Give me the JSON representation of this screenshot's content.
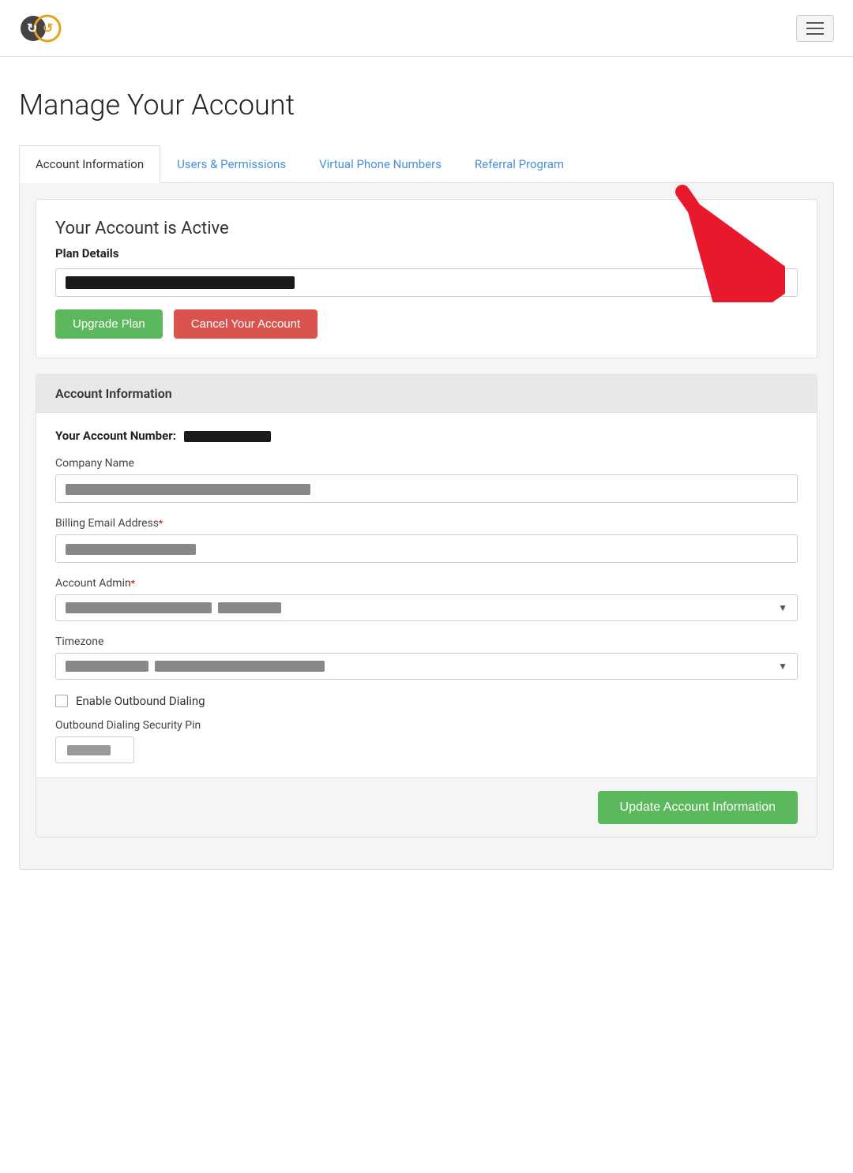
{
  "app": {
    "logo_alt": "CallFire Logo"
  },
  "navbar": {
    "hamburger_label": "Toggle navigation"
  },
  "page": {
    "title": "Manage Your Account"
  },
  "tabs": [
    {
      "id": "account-information",
      "label": "Account Information",
      "active": true
    },
    {
      "id": "users-permissions",
      "label": "Users & Permissions",
      "active": false
    },
    {
      "id": "virtual-phone-numbers",
      "label": "Virtual Phone Numbers",
      "active": false
    },
    {
      "id": "referral-program",
      "label": "Referral Program",
      "active": false
    }
  ],
  "plan_card": {
    "status_text": "Your Account is Active",
    "plan_details_label": "Plan Details",
    "upgrade_button": "Upgrade Plan",
    "cancel_button": "Cancel Your Account"
  },
  "account_info_card": {
    "section_title": "Account Information",
    "account_number_label": "Your Account Number:",
    "company_name_label": "Company Name",
    "billing_email_label": "Billing Email Address",
    "billing_email_required": true,
    "account_admin_label": "Account Admin",
    "account_admin_required": true,
    "timezone_label": "Timezone",
    "enable_outbound_label": "Enable Outbound Dialing",
    "outbound_pin_label": "Outbound Dialing Security Pin",
    "update_button": "Update Account Information"
  }
}
